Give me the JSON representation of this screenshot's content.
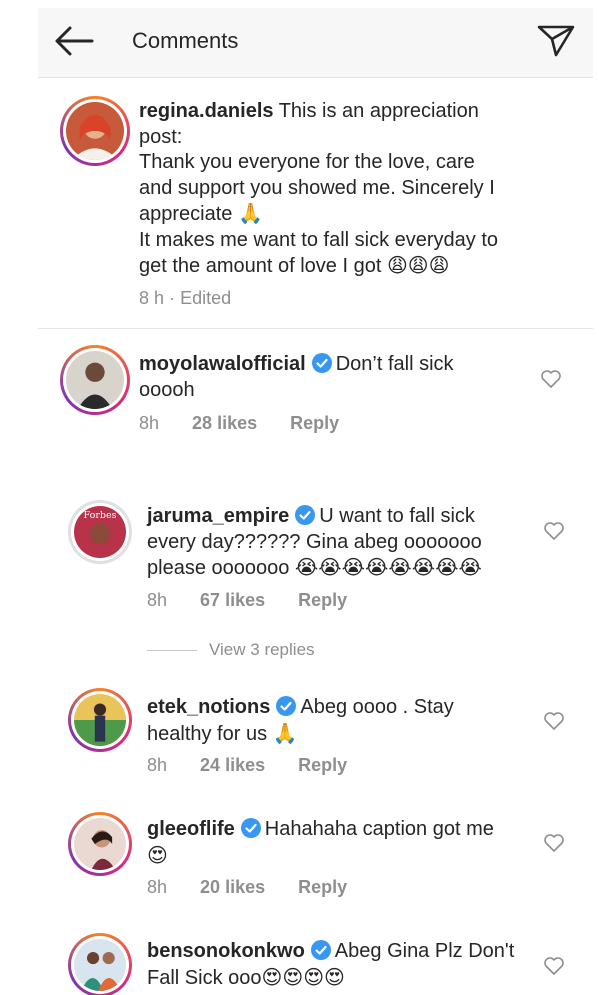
{
  "header": {
    "title": "Comments",
    "back_icon": "arrow-left-icon",
    "send_icon": "paper-plane-icon"
  },
  "caption": {
    "username": "regina.daniels",
    "line1_rest": "This is an appreciation",
    "line2": "post:",
    "line3": "Thank you everyone for the love, care",
    "line4": "and support you showed me. Sincerely I",
    "line5": "appreciate",
    "line5_emoji": "🙏",
    "line6": "It makes me want to fall sick everyday to",
    "line7": "get the amount of love I got",
    "line7_emoji": "😩😩😩",
    "time": "8 h",
    "sep": "·",
    "edited": "Edited"
  },
  "comments": [
    {
      "username": "moyolawalofficial",
      "verified": true,
      "text_line1": "Don’t fall sick",
      "text_line2": "ooooh",
      "emoji": "",
      "time": "8h",
      "likes": "28 likes",
      "reply": "Reply"
    },
    {
      "username": "jaruma_empire",
      "verified": true,
      "text_line1": "U want to fall sick",
      "text_line2": "every day?????? Gina abeg ooooooo",
      "text_line3": "please ooooooo",
      "emoji": "😭😭😭😭😭😭😭😭",
      "time": "8h",
      "likes": "67 likes",
      "reply": "Reply",
      "avatar_text": "Forbes"
    },
    {
      "username": "etek_notions",
      "verified": true,
      "text_line1": "Abeg oooo . Stay",
      "text_line2": "healthy for us",
      "emoji": "🙏",
      "time": "8h",
      "likes": "24 likes",
      "reply": "Reply"
    },
    {
      "username": "gleeoflife",
      "verified": true,
      "text_line1": "Hahahaha caption got me",
      "emoji": "😍",
      "time": "8h",
      "likes": "20 likes",
      "reply": "Reply"
    },
    {
      "username": "bensonokonkwo",
      "verified": true,
      "text_line1": "Abeg Gina Plz Don't",
      "text_line2": "Fall Sick ooo",
      "emoji": "😍😍😍😍"
    }
  ],
  "view_replies": "View 3 replies",
  "colors": {
    "verified": "#3897f0",
    "text": "#262626",
    "muted": "#8e8e8e"
  }
}
